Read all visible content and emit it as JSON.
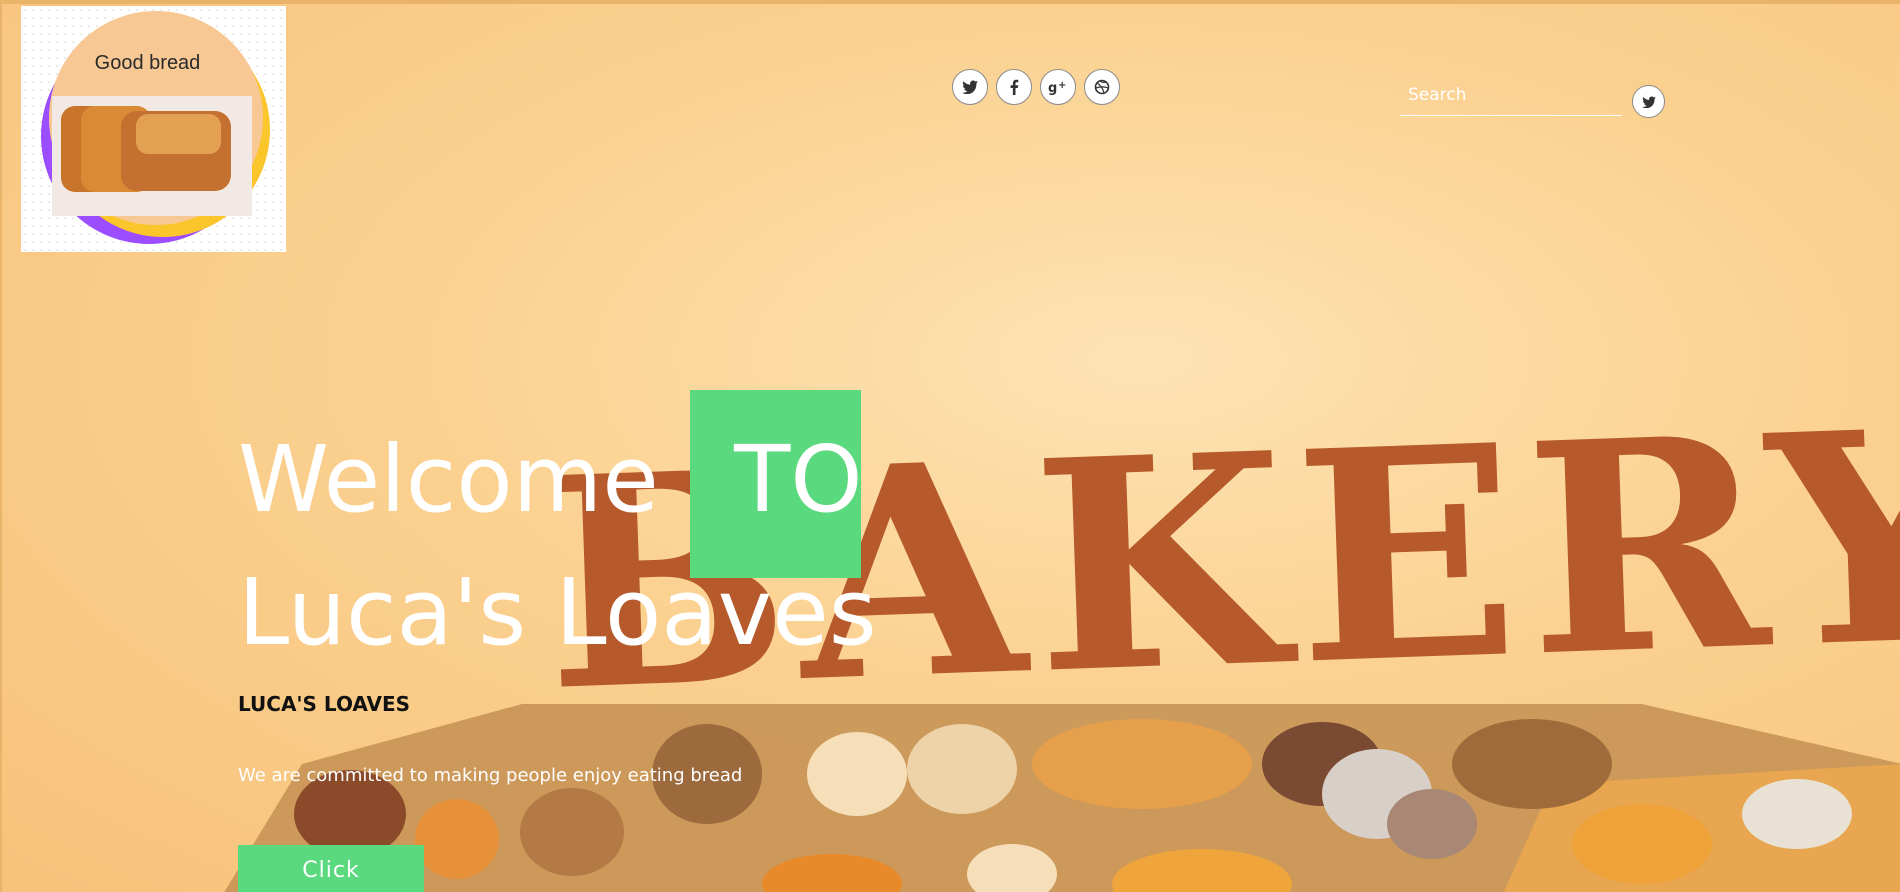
{
  "logo": {
    "text": "Good bread"
  },
  "social": [
    {
      "icon": "twitter-icon",
      "glyph": "🐦"
    },
    {
      "icon": "facebook-icon",
      "glyph": "f"
    },
    {
      "icon": "google-plus-icon",
      "glyph": "g+"
    },
    {
      "icon": "dribbble-icon",
      "glyph": "◍"
    }
  ],
  "search": {
    "placeholder": "Search",
    "value": "",
    "button_icon": "twitter-icon"
  },
  "hero": {
    "title_welcome": "Welcome",
    "title_to": "TO",
    "title_line2": "Luca's Loaves",
    "subtitle": "LUCA'S LOAVES",
    "tagline": "We are committed to making people enjoy eating bread",
    "button_label": "Click",
    "artwork_text": "BAKERY"
  },
  "colors": {
    "accent": "#5bd97f",
    "background": "#fbd190",
    "bakery_letters": "#b65a2b"
  }
}
